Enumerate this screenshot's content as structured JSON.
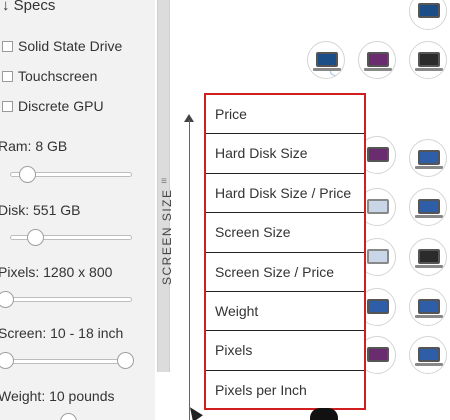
{
  "filters": {
    "specs_title": "↓ Specs",
    "checkboxes": [
      {
        "label": "Solid State Drive",
        "checked": false
      },
      {
        "label": "Touchscreen",
        "checked": false
      },
      {
        "label": "Discrete GPU",
        "checked": false
      }
    ],
    "sliders": [
      {
        "label": "Ram: 8 GB"
      },
      {
        "label": "Disk: 551 GB"
      },
      {
        "label": "Pixels: 1280 x 800"
      },
      {
        "label": "Screen: 10 - 18 inch"
      },
      {
        "label": "Weight: 10 pounds"
      }
    ]
  },
  "axis": {
    "label": "SCREEN SIZE"
  },
  "dropdown": {
    "options": [
      "Price",
      "Hard Disk Size",
      "Hard Disk Size / Price",
      "Screen Size",
      "Screen Size / Price",
      "Weight",
      "Pixels",
      "Pixels per Inch"
    ]
  },
  "splitter": {
    "grip_icon": "≡"
  },
  "colors": {
    "menu_border": "#d11e1e",
    "panel_bg": "#f2f2f2"
  }
}
